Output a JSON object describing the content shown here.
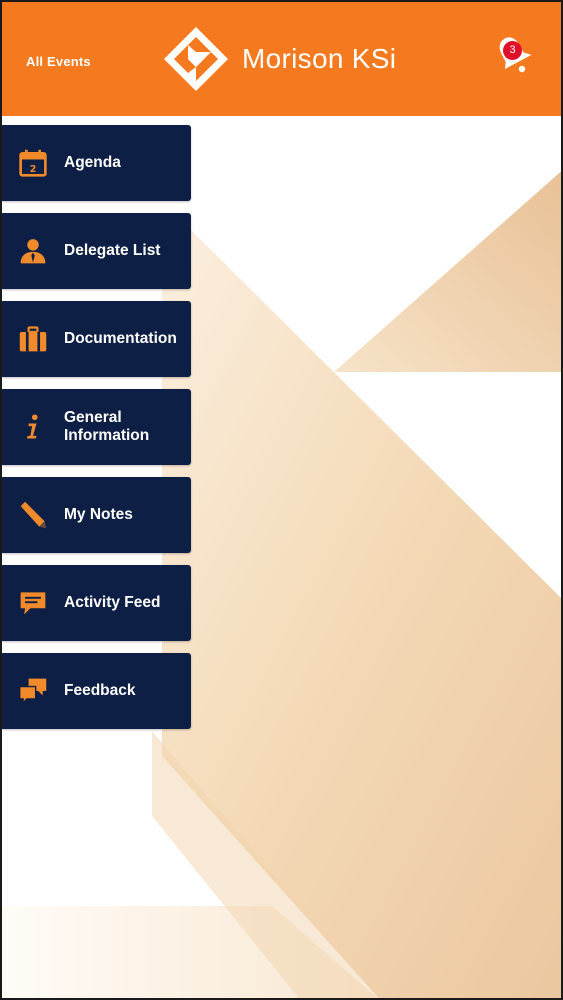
{
  "header": {
    "all_events_label": "All Events",
    "brand_name": "Morison KSi",
    "notification_count": "3",
    "background_color": "#f57a1f"
  },
  "menu": {
    "background_color": "#0e1f45",
    "icon_color": "#f08a2b",
    "items": [
      {
        "label": "Agenda",
        "icon": "calendar-icon"
      },
      {
        "label": "Delegate List",
        "icon": "person-icon"
      },
      {
        "label": "Documentation",
        "icon": "briefcase-icon"
      },
      {
        "label": "General\nInformation",
        "icon": "info-icon"
      },
      {
        "label": "My Notes",
        "icon": "pencil-icon"
      },
      {
        "label": "Activity Feed",
        "icon": "chat-bubble-icon"
      },
      {
        "label": "Feedback",
        "icon": "feedback-bubbles-icon"
      }
    ]
  }
}
